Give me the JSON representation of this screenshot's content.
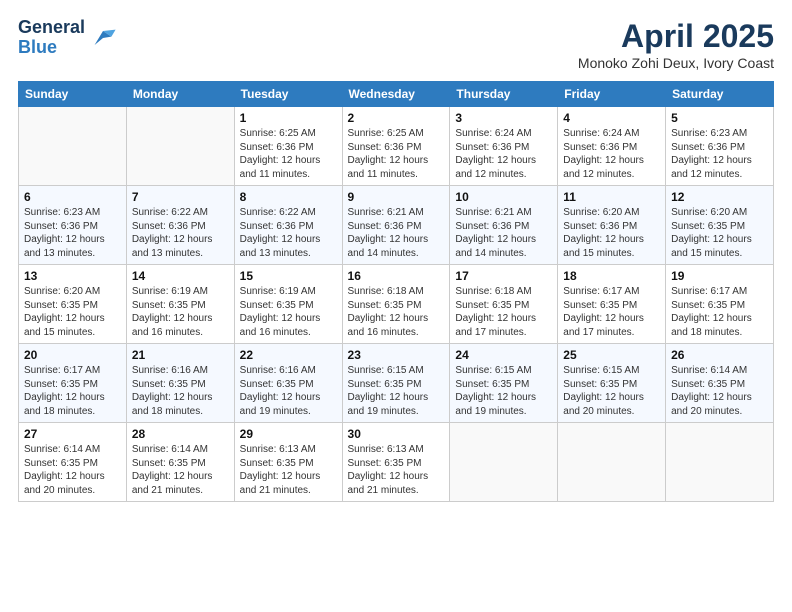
{
  "logo": {
    "general": "General",
    "blue": "Blue"
  },
  "header": {
    "title": "April 2025",
    "subtitle": "Monoko Zohi Deux, Ivory Coast"
  },
  "weekdays": [
    "Sunday",
    "Monday",
    "Tuesday",
    "Wednesday",
    "Thursday",
    "Friday",
    "Saturday"
  ],
  "weeks": [
    [
      {
        "day": "",
        "info": ""
      },
      {
        "day": "",
        "info": ""
      },
      {
        "day": "1",
        "info": "Sunrise: 6:25 AM\nSunset: 6:36 PM\nDaylight: 12 hours and 11 minutes."
      },
      {
        "day": "2",
        "info": "Sunrise: 6:25 AM\nSunset: 6:36 PM\nDaylight: 12 hours and 11 minutes."
      },
      {
        "day": "3",
        "info": "Sunrise: 6:24 AM\nSunset: 6:36 PM\nDaylight: 12 hours and 12 minutes."
      },
      {
        "day": "4",
        "info": "Sunrise: 6:24 AM\nSunset: 6:36 PM\nDaylight: 12 hours and 12 minutes."
      },
      {
        "day": "5",
        "info": "Sunrise: 6:23 AM\nSunset: 6:36 PM\nDaylight: 12 hours and 12 minutes."
      }
    ],
    [
      {
        "day": "6",
        "info": "Sunrise: 6:23 AM\nSunset: 6:36 PM\nDaylight: 12 hours and 13 minutes."
      },
      {
        "day": "7",
        "info": "Sunrise: 6:22 AM\nSunset: 6:36 PM\nDaylight: 12 hours and 13 minutes."
      },
      {
        "day": "8",
        "info": "Sunrise: 6:22 AM\nSunset: 6:36 PM\nDaylight: 12 hours and 13 minutes."
      },
      {
        "day": "9",
        "info": "Sunrise: 6:21 AM\nSunset: 6:36 PM\nDaylight: 12 hours and 14 minutes."
      },
      {
        "day": "10",
        "info": "Sunrise: 6:21 AM\nSunset: 6:36 PM\nDaylight: 12 hours and 14 minutes."
      },
      {
        "day": "11",
        "info": "Sunrise: 6:20 AM\nSunset: 6:36 PM\nDaylight: 12 hours and 15 minutes."
      },
      {
        "day": "12",
        "info": "Sunrise: 6:20 AM\nSunset: 6:35 PM\nDaylight: 12 hours and 15 minutes."
      }
    ],
    [
      {
        "day": "13",
        "info": "Sunrise: 6:20 AM\nSunset: 6:35 PM\nDaylight: 12 hours and 15 minutes."
      },
      {
        "day": "14",
        "info": "Sunrise: 6:19 AM\nSunset: 6:35 PM\nDaylight: 12 hours and 16 minutes."
      },
      {
        "day": "15",
        "info": "Sunrise: 6:19 AM\nSunset: 6:35 PM\nDaylight: 12 hours and 16 minutes."
      },
      {
        "day": "16",
        "info": "Sunrise: 6:18 AM\nSunset: 6:35 PM\nDaylight: 12 hours and 16 minutes."
      },
      {
        "day": "17",
        "info": "Sunrise: 6:18 AM\nSunset: 6:35 PM\nDaylight: 12 hours and 17 minutes."
      },
      {
        "day": "18",
        "info": "Sunrise: 6:17 AM\nSunset: 6:35 PM\nDaylight: 12 hours and 17 minutes."
      },
      {
        "day": "19",
        "info": "Sunrise: 6:17 AM\nSunset: 6:35 PM\nDaylight: 12 hours and 18 minutes."
      }
    ],
    [
      {
        "day": "20",
        "info": "Sunrise: 6:17 AM\nSunset: 6:35 PM\nDaylight: 12 hours and 18 minutes."
      },
      {
        "day": "21",
        "info": "Sunrise: 6:16 AM\nSunset: 6:35 PM\nDaylight: 12 hours and 18 minutes."
      },
      {
        "day": "22",
        "info": "Sunrise: 6:16 AM\nSunset: 6:35 PM\nDaylight: 12 hours and 19 minutes."
      },
      {
        "day": "23",
        "info": "Sunrise: 6:15 AM\nSunset: 6:35 PM\nDaylight: 12 hours and 19 minutes."
      },
      {
        "day": "24",
        "info": "Sunrise: 6:15 AM\nSunset: 6:35 PM\nDaylight: 12 hours and 19 minutes."
      },
      {
        "day": "25",
        "info": "Sunrise: 6:15 AM\nSunset: 6:35 PM\nDaylight: 12 hours and 20 minutes."
      },
      {
        "day": "26",
        "info": "Sunrise: 6:14 AM\nSunset: 6:35 PM\nDaylight: 12 hours and 20 minutes."
      }
    ],
    [
      {
        "day": "27",
        "info": "Sunrise: 6:14 AM\nSunset: 6:35 PM\nDaylight: 12 hours and 20 minutes."
      },
      {
        "day": "28",
        "info": "Sunrise: 6:14 AM\nSunset: 6:35 PM\nDaylight: 12 hours and 21 minutes."
      },
      {
        "day": "29",
        "info": "Sunrise: 6:13 AM\nSunset: 6:35 PM\nDaylight: 12 hours and 21 minutes."
      },
      {
        "day": "30",
        "info": "Sunrise: 6:13 AM\nSunset: 6:35 PM\nDaylight: 12 hours and 21 minutes."
      },
      {
        "day": "",
        "info": ""
      },
      {
        "day": "",
        "info": ""
      },
      {
        "day": "",
        "info": ""
      }
    ]
  ]
}
